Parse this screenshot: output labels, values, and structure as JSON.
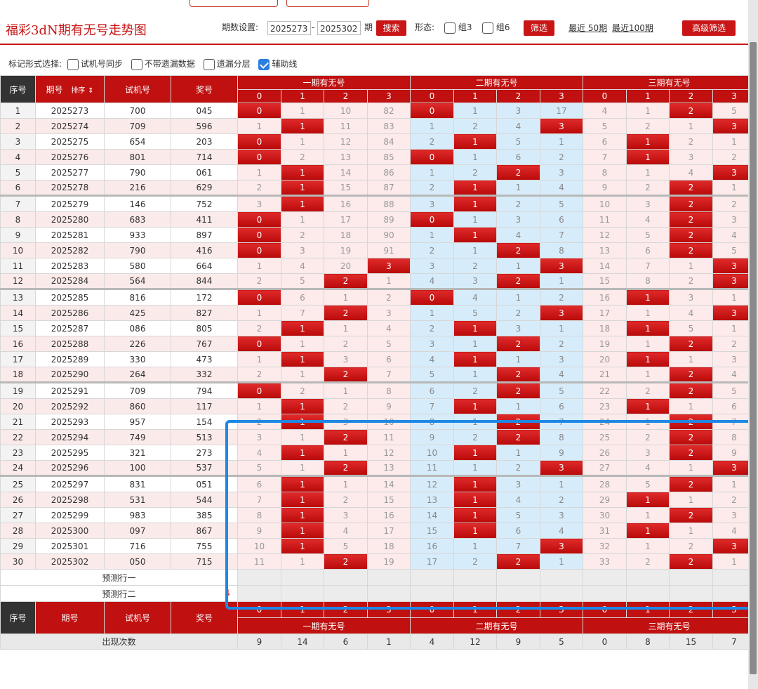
{
  "header": {
    "title": "福彩3dN期有无号走势图",
    "period_label": "期数设置:",
    "period_start": "2025273",
    "period_dash": "-",
    "period_end": "2025302",
    "period_unit": "期",
    "search_label": "搜索",
    "form_label": "形态:",
    "zu3_label": "组3",
    "zu6_label": "组6",
    "filter_label": "筛选",
    "recent50_label": "最近 50期",
    "recent100_label": "最近100期",
    "advanced_label": "高级筛选"
  },
  "markbar": {
    "label": "标记形式选择:",
    "options": [
      {
        "label": "试机号同步",
        "checked": false
      },
      {
        "label": "不带遗漏数据",
        "checked": false
      },
      {
        "label": "遗漏分层",
        "checked": false
      },
      {
        "label": "辅助线",
        "checked": true
      }
    ]
  },
  "table": {
    "col_seq": "序号",
    "col_period": "期号",
    "col_sort": "排序",
    "col_test": "试机号",
    "col_prize": "奖号",
    "groups": [
      "一期有无号",
      "二期有无号",
      "三期有无号"
    ],
    "digits": [
      "0",
      "1",
      "2",
      "3"
    ],
    "rows": [
      {
        "seq": "1",
        "period": "2025273",
        "test": "700",
        "prize": "045",
        "g1": [
          "0",
          "1",
          "10",
          "82"
        ],
        "g2": [
          "0",
          "1",
          "3",
          "17"
        ],
        "g3": [
          "4",
          "1",
          "2",
          "5"
        ]
      },
      {
        "seq": "2",
        "period": "2025274",
        "test": "709",
        "prize": "596",
        "g1": [
          "1",
          "1",
          "11",
          "83"
        ],
        "g2": [
          "1",
          "2",
          "4",
          "3"
        ],
        "g3": [
          "5",
          "2",
          "1",
          "3"
        ]
      },
      {
        "seq": "3",
        "period": "2025275",
        "test": "654",
        "prize": "203",
        "g1": [
          "0",
          "1",
          "12",
          "84"
        ],
        "g2": [
          "2",
          "1",
          "5",
          "1"
        ],
        "g3": [
          "6",
          "1",
          "2",
          "1"
        ]
      },
      {
        "seq": "4",
        "period": "2025276",
        "test": "801",
        "prize": "714",
        "g1": [
          "0",
          "2",
          "13",
          "85"
        ],
        "g2": [
          "0",
          "1",
          "6",
          "2"
        ],
        "g3": [
          "7",
          "1",
          "3",
          "2"
        ]
      },
      {
        "seq": "5",
        "period": "2025277",
        "test": "790",
        "prize": "061",
        "g1": [
          "1",
          "1",
          "14",
          "86"
        ],
        "g2": [
          "1",
          "2",
          "2",
          "3"
        ],
        "g3": [
          "8",
          "1",
          "4",
          "3"
        ]
      },
      {
        "seq": "6",
        "period": "2025278",
        "test": "216",
        "prize": "629",
        "g1": [
          "2",
          "1",
          "15",
          "87"
        ],
        "g2": [
          "2",
          "1",
          "1",
          "4"
        ],
        "g3": [
          "9",
          "2",
          "2",
          "1"
        ]
      },
      {
        "seq": "7",
        "period": "2025279",
        "test": "146",
        "prize": "752",
        "g1": [
          "3",
          "1",
          "16",
          "88"
        ],
        "g2": [
          "3",
          "1",
          "2",
          "5"
        ],
        "g3": [
          "10",
          "3",
          "2",
          "2"
        ]
      },
      {
        "seq": "8",
        "period": "2025280",
        "test": "683",
        "prize": "411",
        "g1": [
          "0",
          "1",
          "17",
          "89"
        ],
        "g2": [
          "0",
          "1",
          "3",
          "6"
        ],
        "g3": [
          "11",
          "4",
          "2",
          "3"
        ]
      },
      {
        "seq": "9",
        "period": "2025281",
        "test": "933",
        "prize": "897",
        "g1": [
          "0",
          "2",
          "18",
          "90"
        ],
        "g2": [
          "1",
          "1",
          "4",
          "7"
        ],
        "g3": [
          "12",
          "5",
          "2",
          "4"
        ]
      },
      {
        "seq": "10",
        "period": "2025282",
        "test": "790",
        "prize": "416",
        "g1": [
          "0",
          "3",
          "19",
          "91"
        ],
        "g2": [
          "2",
          "1",
          "2",
          "8"
        ],
        "g3": [
          "13",
          "6",
          "2",
          "5"
        ]
      },
      {
        "seq": "11",
        "period": "2025283",
        "test": "580",
        "prize": "664",
        "g1": [
          "1",
          "4",
          "20",
          "3"
        ],
        "g2": [
          "3",
          "2",
          "1",
          "3"
        ],
        "g3": [
          "14",
          "7",
          "1",
          "3"
        ]
      },
      {
        "seq": "12",
        "period": "2025284",
        "test": "564",
        "prize": "844",
        "g1": [
          "2",
          "5",
          "2",
          "1"
        ],
        "g2": [
          "4",
          "3",
          "2",
          "1"
        ],
        "g3": [
          "15",
          "8",
          "2",
          "3"
        ]
      },
      {
        "seq": "13",
        "period": "2025285",
        "test": "816",
        "prize": "172",
        "g1": [
          "0",
          "6",
          "1",
          "2"
        ],
        "g2": [
          "0",
          "4",
          "1",
          "2"
        ],
        "g3": [
          "16",
          "1",
          "3",
          "1"
        ]
      },
      {
        "seq": "14",
        "period": "2025286",
        "test": "425",
        "prize": "827",
        "g1": [
          "1",
          "7",
          "2",
          "3"
        ],
        "g2": [
          "1",
          "5",
          "2",
          "3"
        ],
        "g3": [
          "17",
          "1",
          "4",
          "3"
        ]
      },
      {
        "seq": "15",
        "period": "2025287",
        "test": "086",
        "prize": "805",
        "g1": [
          "2",
          "1",
          "1",
          "4"
        ],
        "g2": [
          "2",
          "1",
          "3",
          "1"
        ],
        "g3": [
          "18",
          "1",
          "5",
          "1"
        ]
      },
      {
        "seq": "16",
        "period": "2025288",
        "test": "226",
        "prize": "767",
        "g1": [
          "0",
          "1",
          "2",
          "5"
        ],
        "g2": [
          "3",
          "1",
          "2",
          "2"
        ],
        "g3": [
          "19",
          "1",
          "2",
          "2"
        ]
      },
      {
        "seq": "17",
        "period": "2025289",
        "test": "330",
        "prize": "473",
        "g1": [
          "1",
          "1",
          "3",
          "6"
        ],
        "g2": [
          "4",
          "1",
          "1",
          "3"
        ],
        "g3": [
          "20",
          "1",
          "1",
          "3"
        ]
      },
      {
        "seq": "18",
        "period": "2025290",
        "test": "264",
        "prize": "332",
        "g1": [
          "2",
          "1",
          "2",
          "7"
        ],
        "g2": [
          "5",
          "1",
          "2",
          "4"
        ],
        "g3": [
          "21",
          "1",
          "2",
          "4"
        ]
      },
      {
        "seq": "19",
        "period": "2025291",
        "test": "709",
        "prize": "794",
        "g1": [
          "0",
          "2",
          "1",
          "8"
        ],
        "g2": [
          "6",
          "2",
          "2",
          "5"
        ],
        "g3": [
          "22",
          "2",
          "2",
          "5"
        ]
      },
      {
        "seq": "20",
        "period": "2025292",
        "test": "860",
        "prize": "117",
        "g1": [
          "1",
          "1",
          "2",
          "9"
        ],
        "g2": [
          "7",
          "1",
          "1",
          "6"
        ],
        "g3": [
          "23",
          "1",
          "1",
          "6"
        ]
      },
      {
        "seq": "21",
        "period": "2025293",
        "test": "957",
        "prize": "154",
        "g1": [
          "2",
          "1",
          "3",
          "10"
        ],
        "g2": [
          "8",
          "1",
          "2",
          "7"
        ],
        "g3": [
          "24",
          "1",
          "2",
          "7"
        ]
      },
      {
        "seq": "22",
        "period": "2025294",
        "test": "749",
        "prize": "513",
        "g1": [
          "3",
          "1",
          "2",
          "11"
        ],
        "g2": [
          "9",
          "2",
          "2",
          "8"
        ],
        "g3": [
          "25",
          "2",
          "2",
          "8"
        ]
      },
      {
        "seq": "23",
        "period": "2025295",
        "test": "321",
        "prize": "273",
        "g1": [
          "4",
          "1",
          "1",
          "12"
        ],
        "g2": [
          "10",
          "1",
          "1",
          "9"
        ],
        "g3": [
          "26",
          "3",
          "2",
          "9"
        ]
      },
      {
        "seq": "24",
        "period": "2025296",
        "test": "100",
        "prize": "537",
        "g1": [
          "5",
          "1",
          "2",
          "13"
        ],
        "g2": [
          "11",
          "1",
          "2",
          "3"
        ],
        "g3": [
          "27",
          "4",
          "1",
          "3"
        ]
      },
      {
        "seq": "25",
        "period": "2025297",
        "test": "831",
        "prize": "051",
        "g1": [
          "6",
          "1",
          "1",
          "14"
        ],
        "g2": [
          "12",
          "1",
          "3",
          "1"
        ],
        "g3": [
          "28",
          "5",
          "2",
          "1"
        ]
      },
      {
        "seq": "26",
        "period": "2025298",
        "test": "531",
        "prize": "544",
        "g1": [
          "7",
          "1",
          "2",
          "15"
        ],
        "g2": [
          "13",
          "1",
          "4",
          "2"
        ],
        "g3": [
          "29",
          "1",
          "1",
          "2"
        ]
      },
      {
        "seq": "27",
        "period": "2025299",
        "test": "983",
        "prize": "385",
        "g1": [
          "8",
          "1",
          "3",
          "16"
        ],
        "g2": [
          "14",
          "1",
          "5",
          "3"
        ],
        "g3": [
          "30",
          "1",
          "2",
          "3"
        ]
      },
      {
        "seq": "28",
        "period": "2025300",
        "test": "097",
        "prize": "867",
        "g1": [
          "9",
          "1",
          "4",
          "17"
        ],
        "g2": [
          "15",
          "1",
          "6",
          "4"
        ],
        "g3": [
          "31",
          "1",
          "1",
          "4"
        ]
      },
      {
        "seq": "29",
        "period": "2025301",
        "test": "716",
        "prize": "755",
        "g1": [
          "10",
          "1",
          "5",
          "18"
        ],
        "g2": [
          "16",
          "1",
          "7",
          "3"
        ],
        "g3": [
          "32",
          "1",
          "2",
          "3"
        ]
      },
      {
        "seq": "30",
        "period": "2025302",
        "test": "050",
        "prize": "715",
        "g1": [
          "11",
          "1",
          "2",
          "19"
        ],
        "g2": [
          "17",
          "2",
          "2",
          "1"
        ],
        "g3": [
          "33",
          "2",
          "2",
          "1"
        ]
      }
    ],
    "hits": [
      {
        "g1": [
          0
        ],
        "g2": [
          0
        ],
        "g3": [
          2
        ]
      },
      {
        "g1": [
          1
        ],
        "g2": [
          3
        ],
        "g3": [
          3
        ]
      },
      {
        "g1": [
          0
        ],
        "g2": [
          1
        ],
        "g3": [
          1
        ]
      },
      {
        "g1": [
          0
        ],
        "g2": [
          0
        ],
        "g3": [
          1
        ]
      },
      {
        "g1": [
          1
        ],
        "g2": [
          2
        ],
        "g3": [
          3
        ]
      },
      {
        "g1": [
          1
        ],
        "g2": [
          1
        ],
        "g3": [
          2
        ]
      },
      {
        "g1": [
          1
        ],
        "g2": [
          1
        ],
        "g3": [
          2
        ]
      },
      {
        "g1": [
          0
        ],
        "g2": [
          0
        ],
        "g3": [
          2
        ]
      },
      {
        "g1": [
          0
        ],
        "g2": [
          1
        ],
        "g3": [
          2
        ]
      },
      {
        "g1": [
          0
        ],
        "g2": [
          2
        ],
        "g3": [
          2
        ]
      },
      {
        "g1": [
          3
        ],
        "g2": [
          3
        ],
        "g3": [
          3
        ]
      },
      {
        "g1": [
          2
        ],
        "g2": [
          2
        ],
        "g3": [
          3
        ]
      },
      {
        "g1": [
          0
        ],
        "g2": [
          0
        ],
        "g3": [
          1
        ]
      },
      {
        "g1": [
          2
        ],
        "g2": [
          3
        ],
        "g3": [
          3
        ]
      },
      {
        "g1": [
          1
        ],
        "g2": [
          1
        ],
        "g3": [
          1
        ]
      },
      {
        "g1": [
          0
        ],
        "g2": [
          2
        ],
        "g3": [
          2
        ]
      },
      {
        "g1": [
          1
        ],
        "g2": [
          1
        ],
        "g3": [
          1
        ]
      },
      {
        "g1": [
          2
        ],
        "g2": [
          2
        ],
        "g3": [
          2
        ]
      },
      {
        "g1": [
          0
        ],
        "g2": [
          2
        ],
        "g3": [
          2
        ]
      },
      {
        "g1": [
          1
        ],
        "g2": [
          1
        ],
        "g3": [
          1
        ]
      },
      {
        "g1": [
          1
        ],
        "g2": [
          2
        ],
        "g3": [
          2
        ]
      },
      {
        "g1": [
          2
        ],
        "g2": [
          2
        ],
        "g3": [
          2
        ]
      },
      {
        "g1": [
          1
        ],
        "g2": [
          1
        ],
        "g3": [
          2
        ]
      },
      {
        "g1": [
          2
        ],
        "g2": [
          3
        ],
        "g3": [
          3
        ]
      },
      {
        "g1": [
          1
        ],
        "g2": [
          1
        ],
        "g3": [
          2
        ]
      },
      {
        "g1": [
          1
        ],
        "g2": [
          1
        ],
        "g3": [
          1
        ]
      },
      {
        "g1": [
          1
        ],
        "g2": [
          1
        ],
        "g3": [
          2
        ]
      },
      {
        "g1": [
          1
        ],
        "g2": [
          1
        ],
        "g3": [
          1
        ]
      },
      {
        "g1": [
          1
        ],
        "g2": [
          3
        ],
        "g3": [
          3
        ]
      },
      {
        "g1": [
          2
        ],
        "g2": [
          2
        ],
        "g3": [
          2
        ]
      }
    ],
    "predict1": "预测行一",
    "predict2": "预测行二",
    "footer_cols": {
      "seq": "序号",
      "period": "期号",
      "test": "试机号",
      "prize": "奖号"
    },
    "stat_label": "出现次数",
    "stat_values": [
      "9",
      "14",
      "6",
      "1",
      "4",
      "12",
      "9",
      "5",
      "0",
      "8",
      "15",
      "7"
    ]
  },
  "colors": {
    "accent": "#c91515",
    "hit": "#c01010",
    "highlight": "#1e88e5",
    "blue_zone": "#d6ecfa",
    "pink_zone": "#fdeaea"
  }
}
